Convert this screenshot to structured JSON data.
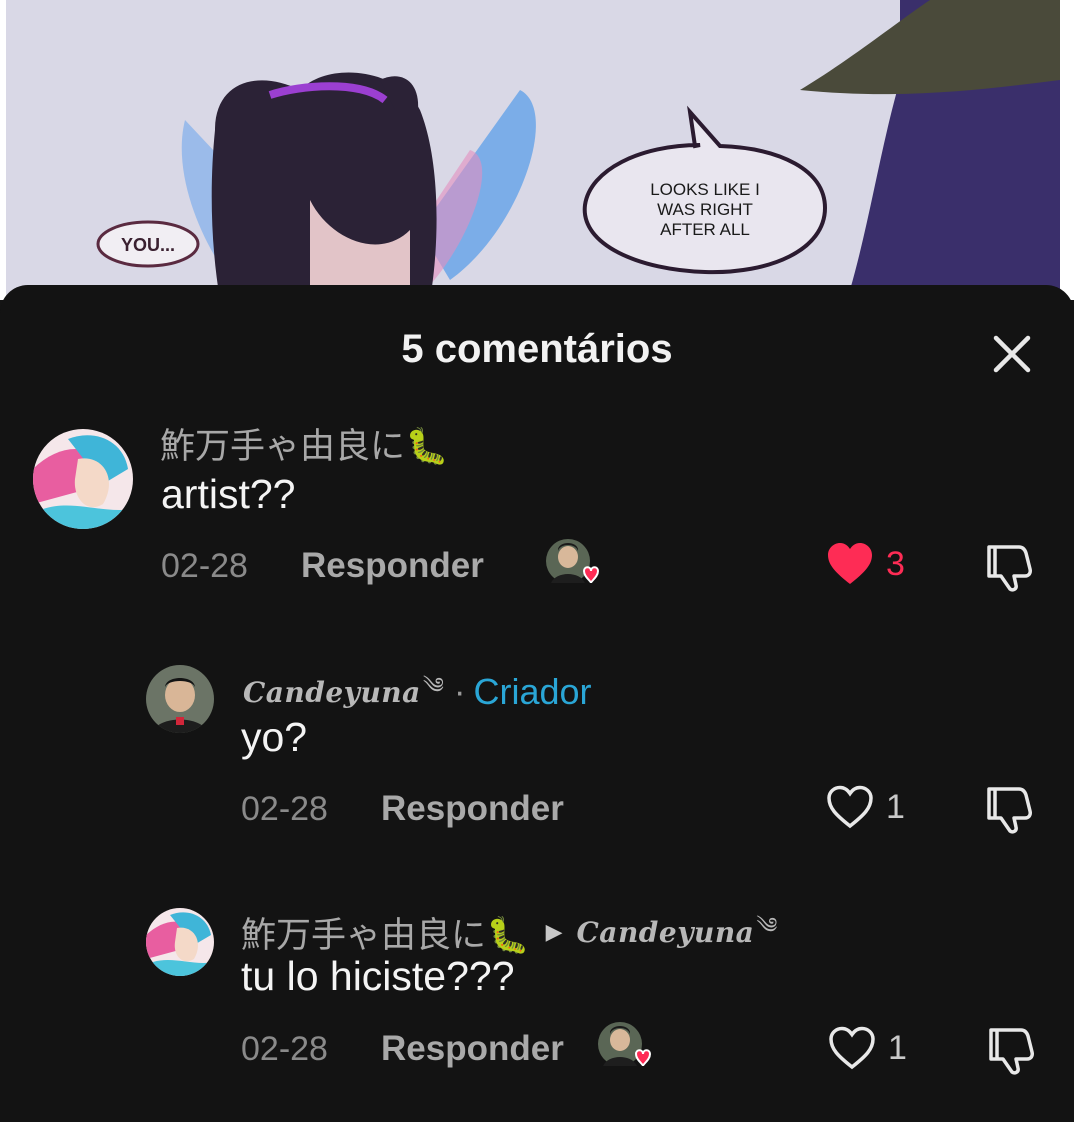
{
  "art": {
    "bubble_left": "YOU...",
    "bubble_right": [
      "LOOKS LIKE I",
      "WAS RIGHT",
      "AFTER ALL"
    ]
  },
  "sheet": {
    "title": "5 comentários",
    "close_icon": "close-icon"
  },
  "comments": [
    {
      "author": "鮓万手ゃ由良に🐛",
      "text": "artist??",
      "date": "02-28",
      "reply_label": "Responder",
      "likes": "3",
      "liked": true,
      "like_color": "#fe2c55"
    },
    {
      "author": "Candeyuna",
      "creator_badge": "Criador",
      "separator": "·",
      "text": "yo?",
      "date": "02-28",
      "reply_label": "Responder",
      "likes": "1",
      "liked": false
    },
    {
      "author": "鮓万手ゃ由良に🐛",
      "reply_to": "Candeyuna",
      "text": "tu lo hiciste???",
      "date": "02-28",
      "reply_label": "Responder",
      "likes": "1",
      "liked": false
    }
  ],
  "colors": {
    "background": "#131313",
    "creator": "#2aa6d6",
    "like_active": "#fe2c55"
  }
}
